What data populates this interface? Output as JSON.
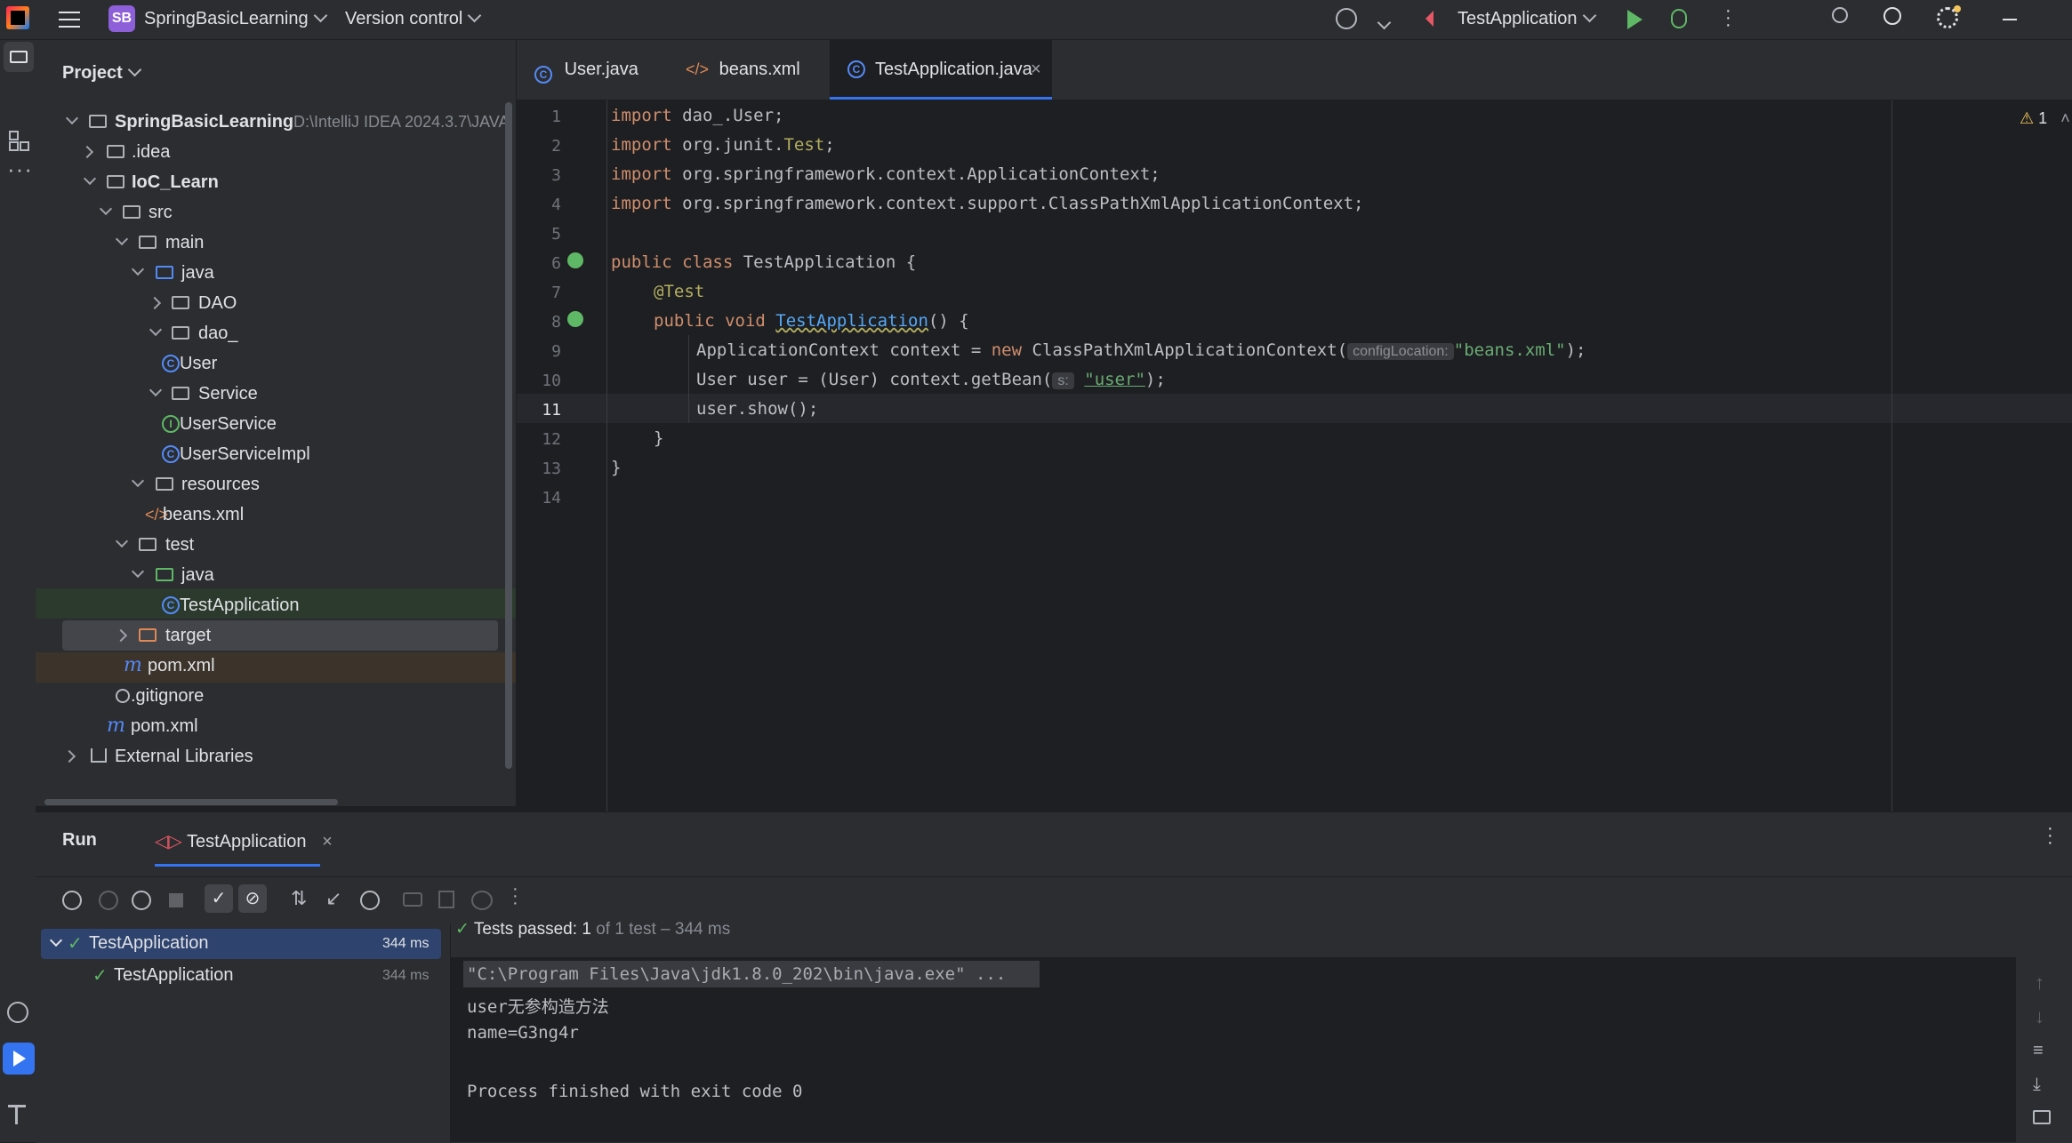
{
  "titlebar": {
    "project_badge": "SB",
    "project_name": "SpringBasicLearning",
    "vcs_label": "Version control",
    "run_config": "TestApplication"
  },
  "project_panel": {
    "title": "Project",
    "tree": [
      {
        "label": "SpringBasicLearning",
        "suffix": "D:\\IntelliJ IDEA 2024.3.7\\JAVA"
      },
      {
        "label": ".idea"
      },
      {
        "label": "IoC_Learn"
      },
      {
        "label": "src"
      },
      {
        "label": "main"
      },
      {
        "label": "java"
      },
      {
        "label": "DAO"
      },
      {
        "label": "dao_"
      },
      {
        "label": "User"
      },
      {
        "label": "Service"
      },
      {
        "label": "UserService"
      },
      {
        "label": "UserServiceImpl"
      },
      {
        "label": "resources"
      },
      {
        "label": "beans.xml"
      },
      {
        "label": "test"
      },
      {
        "label": "java"
      },
      {
        "label": "TestApplication"
      },
      {
        "label": "target"
      },
      {
        "label": "pom.xml"
      },
      {
        "label": ".gitignore"
      },
      {
        "label": "pom.xml"
      },
      {
        "label": "External Libraries"
      }
    ]
  },
  "editor": {
    "tabs": [
      "User.java",
      "beans.xml",
      "TestApplication.java"
    ],
    "active_tab": "TestApplication.java",
    "warning_count": "1",
    "line_numbers": [
      "1",
      "2",
      "3",
      "4",
      "5",
      "6",
      "7",
      "8",
      "9",
      "10",
      "11",
      "12",
      "13",
      "14"
    ],
    "code": {
      "l1_kw": "import",
      "l1_rest": " dao_.User;",
      "l2_kw": "import",
      "l2_rest": " org.junit.",
      "l2_ann": "Test",
      "l2_end": ";",
      "l3_kw": "import",
      "l3_rest": " org.springframework.context.ApplicationContext;",
      "l4_kw": "import",
      "l4_rest": " org.springframework.context.support.ClassPathXmlApplicationContext;",
      "l6_kw": "public class",
      "l6_rest": " TestApplication {",
      "l7_ann": "@Test",
      "l8_kw": "public void",
      "l8_fn": "TestApplication",
      "l8_rest": "() {",
      "l9_a": "ApplicationContext context = ",
      "l9_kw": "new",
      "l9_b": " ClassPathXmlApplicationContext(",
      "l9_hint": "configLocation:",
      "l9_str": "\"beans.xml\"",
      "l9_end": ");",
      "l10_a": "User user = (User) context.getBean(",
      "l10_hint": "s:",
      "l10_str": "\"user\"",
      "l10_end": ");",
      "l11": "user.show();",
      "l12": "}",
      "l13": "}"
    }
  },
  "run_panel": {
    "title": "Run",
    "tab": "TestApplication",
    "tests": [
      {
        "name": "TestApplication",
        "time": "344 ms"
      },
      {
        "name": "TestApplication",
        "time": "344 ms"
      }
    ],
    "status_label": "Tests passed:",
    "status_count": "1",
    "status_rest": "of 1 test – 344 ms",
    "console": [
      "\"C:\\Program Files\\Java\\jdk1.8.0_202\\bin\\java.exe\" ...",
      "user无参构造方法",
      "name=G3ng4r",
      "",
      "Process finished with exit code 0"
    ]
  },
  "colors": {
    "accent": "#3574f0",
    "green": "#5fb865",
    "bg": "#1e1f22",
    "panel": "#2b2d30"
  }
}
